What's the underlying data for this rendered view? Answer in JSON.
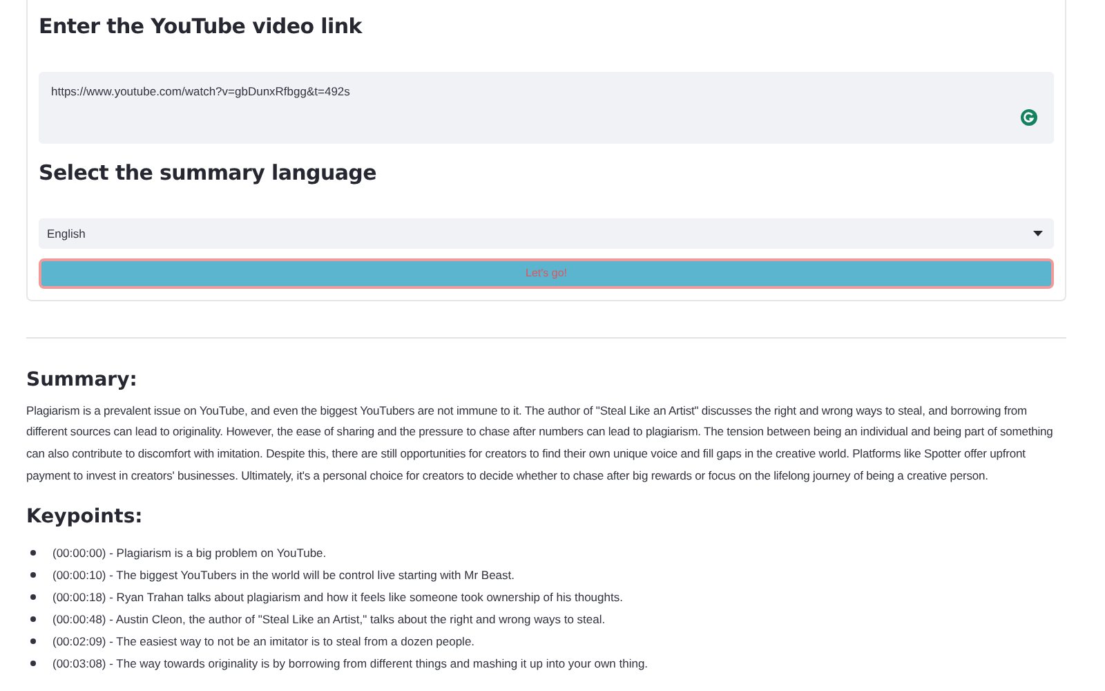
{
  "form": {
    "link_heading": "Enter the YouTube video link",
    "link_value": "https://www.youtube.com/watch?v=gbDunxRfbgg&t=492s",
    "language_heading": "Select the summary language",
    "language_value": "English",
    "button": "Let's go!"
  },
  "summary": {
    "heading": "Summary:",
    "text": "Plagiarism is a prevalent issue on YouTube, and even the biggest YouTubers are not immune to it. The author of \"Steal Like an Artist\" discusses the right and wrong ways to steal, and borrowing from different sources can lead to originality. However, the ease of sharing and the pressure to chase after numbers can lead to plagiarism. The tension between being an individual and being part of something can also contribute to discomfort with imitation. Despite this, there are still opportunities for creators to find their own unique voice and fill gaps in the creative world. Platforms like Spotter offer upfront payment to invest in creators' businesses. Ultimately, it's a personal choice for creators to decide whether to chase after big rewards or focus on the lifelong journey of being a creative person."
  },
  "keypoints": {
    "heading": "Keypoints:",
    "items": [
      "(00:00:00) - Plagiarism is a big problem on YouTube.",
      "(00:00:10) - The biggest YouTubers in the world will be control live starting with Mr Beast.",
      "(00:00:18) - Ryan Trahan talks about plagiarism and how it feels like someone took ownership of his thoughts.",
      "(00:00:48) - Austin Cleon, the author of \"Steal Like an Artist,\" talks about the right and wrong ways to steal.",
      "(00:02:09) - The easiest way to not be an imitator is to steal from a dozen people.",
      "(00:03:08) - The way towards originality is by borrowing from different things and mashing it up into your own thing."
    ]
  }
}
